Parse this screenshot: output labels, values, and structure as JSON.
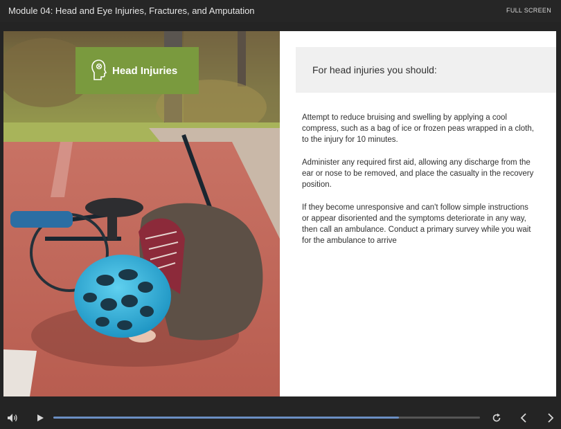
{
  "header": {
    "title": "Module 04: Head and Eye Injuries, Fractures, and Amputation",
    "fullscreen_label": "FULL SCREEN"
  },
  "slide": {
    "photo_description_icon": "photo-child-fallen-from-bicycle",
    "badge": {
      "icon": "head-icon",
      "label": "Head Injuries"
    },
    "panel_title": "For head injuries you should:",
    "paragraphs": [
      "Attempt to reduce bruising and swelling by applying a cool compress, such as a bag of ice or frozen peas wrapped in a cloth, to the injury for 10 minutes.",
      "Administer any required first aid, allowing any discharge from the ear or nose to be removed, and place the casualty in the recovery position.",
      "If they become unresponsive and can't follow simple instructions or appear disoriented and the symptoms deteriorate in any way, then call an ambulance. Conduct a primary survey while you wait for the ambulance to arrive"
    ]
  },
  "player": {
    "progress_fraction": 0.81,
    "icons": [
      "volume-icon",
      "play-icon",
      "replay-icon",
      "previous-icon",
      "next-icon"
    ]
  },
  "colors": {
    "badge": "#7a9a3e",
    "progress": "#6b8fc4",
    "background": "#242424"
  }
}
